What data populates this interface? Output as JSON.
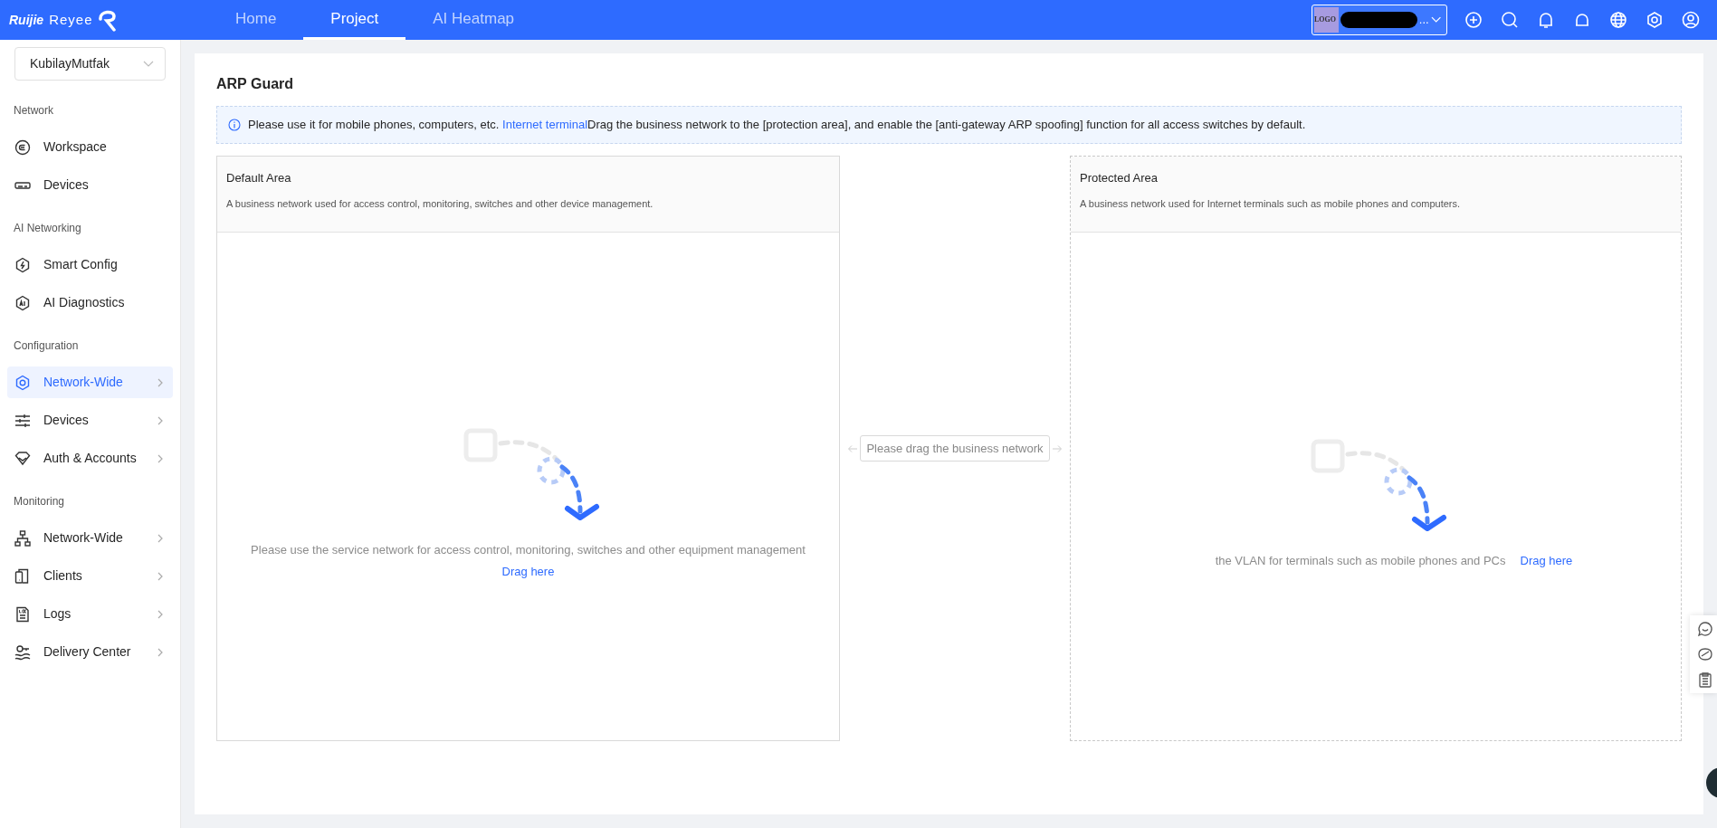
{
  "header": {
    "brand": "Ruijie",
    "product": "Reyee",
    "nav": [
      {
        "label": "Home",
        "selected": false
      },
      {
        "label": "Project",
        "selected": true
      },
      {
        "label": "AI Heatmap",
        "selected": false
      }
    ],
    "project_selector": {
      "logo_text": "LOGO",
      "name_suffix": "..."
    }
  },
  "sidebar": {
    "network_select": "KubilayMutfak",
    "items": [
      {
        "kind": "section",
        "label": "Network"
      },
      {
        "kind": "item",
        "label": "Workspace",
        "submenu": false,
        "selected": false
      },
      {
        "kind": "item",
        "label": "Devices",
        "submenu": false,
        "selected": false
      },
      {
        "kind": "section",
        "label": "AI Networking"
      },
      {
        "kind": "item",
        "label": "Smart Config",
        "submenu": false,
        "selected": false
      },
      {
        "kind": "item",
        "label": "AI Diagnostics",
        "submenu": false,
        "selected": false
      },
      {
        "kind": "section",
        "label": "Configuration"
      },
      {
        "kind": "item",
        "label": "Network-Wide",
        "submenu": true,
        "selected": true
      },
      {
        "kind": "item",
        "label": "Devices",
        "submenu": true,
        "selected": false
      },
      {
        "kind": "item",
        "label": "Auth & Accounts",
        "submenu": true,
        "selected": false
      },
      {
        "kind": "section",
        "label": "Monitoring"
      },
      {
        "kind": "item",
        "label": "Network-Wide",
        "submenu": true,
        "selected": false
      },
      {
        "kind": "item",
        "label": "Clients",
        "submenu": true,
        "selected": false
      },
      {
        "kind": "item",
        "label": "Logs",
        "submenu": true,
        "selected": false
      },
      {
        "kind": "item",
        "label": "Delivery Center",
        "submenu": true,
        "selected": false
      }
    ]
  },
  "page": {
    "title": "ARP Guard",
    "notice": {
      "before": "Please use it for mobile phones, computers, etc.",
      "link": "Internet terminal",
      "after": "Drag the business network to the [protection area], and enable the [anti-gateway ARP spoofing] function for all access switches by default."
    },
    "areas": [
      {
        "kind": "solid",
        "title": "Default Area",
        "description": "A business network used for access control, monitoring, switches and other device management.",
        "empty_text": "Please use the service network for access control, monitoring, switches and other equipment management",
        "link": "Drag here"
      },
      {
        "kind": "dashed",
        "title": "Protected Area",
        "description": "A business network used for Internet terminals such as mobile phones and computers.",
        "empty_text": "the VLAN for terminals such as mobile phones and PCs",
        "link": "Drag here"
      }
    ],
    "drag_hint": "Please drag the business network"
  }
}
